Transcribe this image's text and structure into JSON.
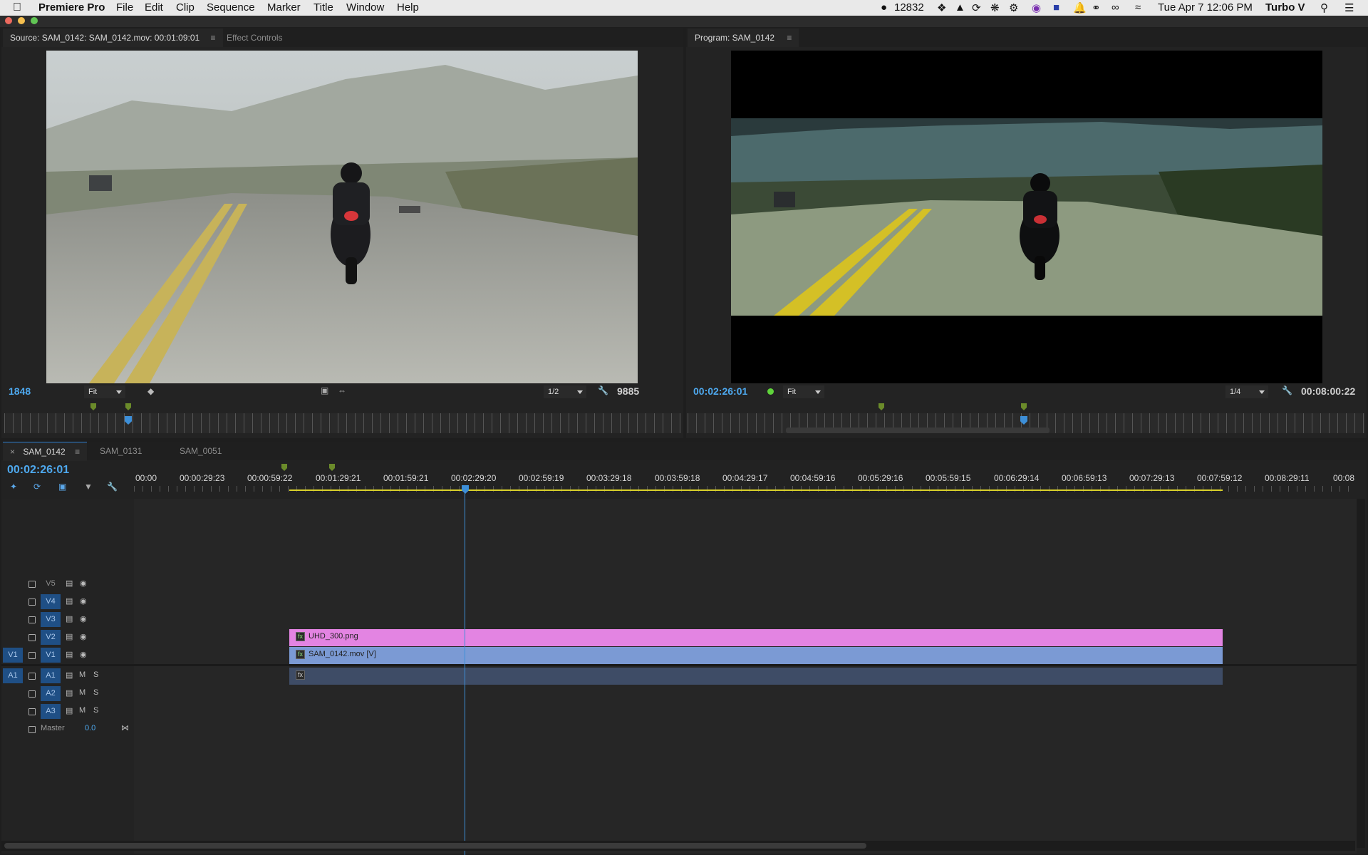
{
  "menubar": {
    "app": "Premiere Pro",
    "items": [
      "File",
      "Edit",
      "Clip",
      "Sequence",
      "Marker",
      "Title",
      "Window",
      "Help"
    ],
    "status_count": "12832",
    "datetime": "Tue Apr 7  12:06 PM",
    "user": "Turbo V"
  },
  "source": {
    "tab_title": "Source: SAM_0142: SAM_0142.mov: 00:01:09:01",
    "tab_effects": "Effect Controls",
    "left_value": "1848",
    "zoom": "Fit",
    "resolution": "1/2",
    "right_value": "9885"
  },
  "program": {
    "tab_title": "Program: SAM_0142",
    "timecode": "00:02:26:01",
    "zoom": "Fit",
    "resolution": "1/4",
    "duration": "00:08:00:22"
  },
  "timeline": {
    "tabs": [
      "SAM_0142",
      "SAM_0131",
      "SAM_0051"
    ],
    "timecode": "00:02:26:01",
    "ruler": [
      "00:00",
      "00:00:29:23",
      "00:00:59:22",
      "00:01:29:21",
      "00:01:59:21",
      "00:02:29:20",
      "00:02:59:19",
      "00:03:29:18",
      "00:03:59:18",
      "00:04:29:17",
      "00:04:59:16",
      "00:05:29:16",
      "00:05:59:15",
      "00:06:29:14",
      "00:06:59:13",
      "00:07:29:13",
      "00:07:59:12",
      "00:08:29:11",
      "00:08"
    ],
    "video_tracks": [
      "V5",
      "V4",
      "V3",
      "V2",
      "V1"
    ],
    "v1_source": "V1",
    "audio_tracks": [
      "A1",
      "A2",
      "A3"
    ],
    "a1_source": "A1",
    "audio_labels": {
      "mute": "M",
      "solo": "S"
    },
    "master_label": "Master",
    "master_value": "0.0",
    "clips": {
      "v2": "UHD_300.png",
      "v1": "SAM_0142.mov [V]",
      "fx": "fx"
    },
    "colors": {
      "v2_clip": "#e384e2",
      "v1_clip": "#7b9ad4",
      "a1_clip": "#3e4c66",
      "playhead": "#3d8fd8",
      "accent": "#4ea9ef"
    }
  }
}
